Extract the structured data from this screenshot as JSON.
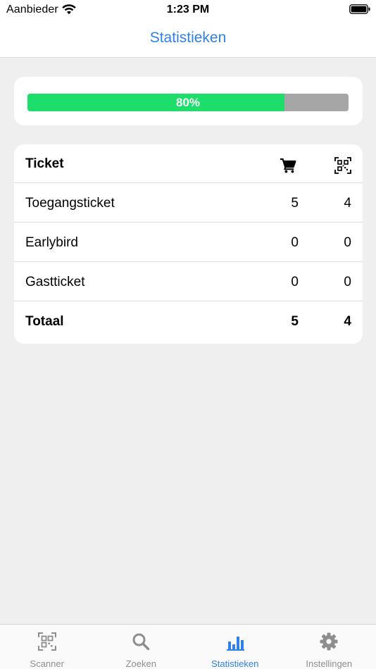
{
  "status_bar": {
    "carrier": "Aanbieder",
    "time": "1:23 PM"
  },
  "nav": {
    "title": "Statistieken"
  },
  "progress": {
    "value": 0.8,
    "label": "80%",
    "fill_color": "#1ede6b",
    "track_color": "#a6a6a6"
  },
  "table": {
    "header": {
      "name": "Ticket",
      "col1_icon": "cart-icon",
      "col2_icon": "qr-code-icon"
    },
    "rows": [
      {
        "name": "Toegangsticket",
        "sold": "5",
        "scanned": "4"
      },
      {
        "name": "Earlybird",
        "sold": "0",
        "scanned": "0"
      },
      {
        "name": "Gastticket",
        "sold": "0",
        "scanned": "0"
      }
    ],
    "total": {
      "name": "Totaal",
      "sold": "5",
      "scanned": "4"
    }
  },
  "tab_bar": {
    "active": "Statistieken",
    "accent_color": "#2f80e8",
    "items": [
      {
        "label": "Scanner",
        "icon": "qr-scan-icon"
      },
      {
        "label": "Zoeken",
        "icon": "search-icon"
      },
      {
        "label": "Statistieken",
        "icon": "bar-chart-icon"
      },
      {
        "label": "Instellingen",
        "icon": "gear-icon"
      }
    ]
  }
}
